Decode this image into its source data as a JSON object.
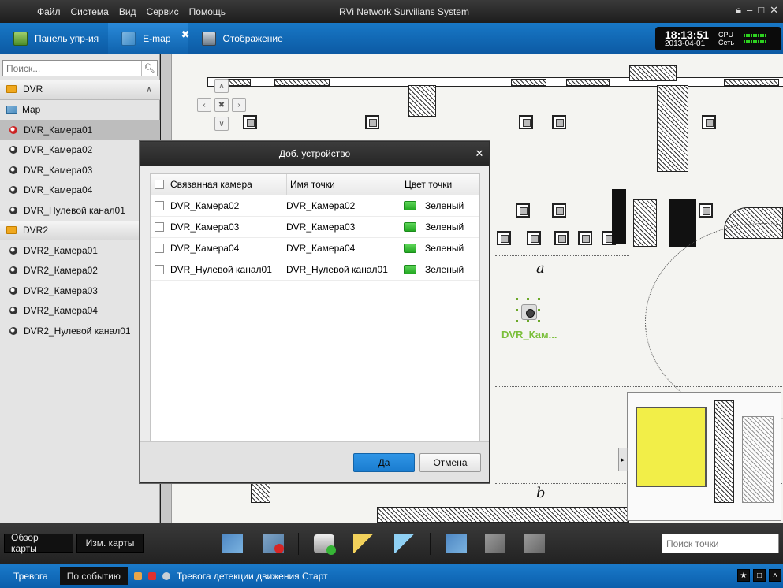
{
  "menubar": {
    "items": [
      "Файл",
      "Система",
      "Вид",
      "Сервис",
      "Помощь"
    ],
    "title": "RVi Network Survilians System",
    "controls": [
      "lock-icon",
      "minimize-icon",
      "maximize-icon",
      "close-icon"
    ]
  },
  "tabs": [
    {
      "label": "Панель упр-ия",
      "icon": "control-panel-icon"
    },
    {
      "label": "E-map",
      "icon": "emap-icon",
      "active": true
    },
    {
      "label": "Отображение",
      "icon": "monitor-icon"
    }
  ],
  "clock": {
    "time": "18:13:51",
    "date": "2013-04-01",
    "cpu_label": "CPU",
    "net_label": "Сеть"
  },
  "sidebar": {
    "search_placeholder": "Поиск...",
    "tree": [
      {
        "label": "DVR",
        "type": "group"
      },
      {
        "label": "Map",
        "type": "map"
      },
      {
        "label": "DVR_Камера01",
        "type": "camera-red",
        "selected": true
      },
      {
        "label": "DVR_Камера02",
        "type": "camera"
      },
      {
        "label": "DVR_Камера03",
        "type": "camera"
      },
      {
        "label": "DVR_Камера04",
        "type": "camera"
      },
      {
        "label": "DVR_Нулевой канал01",
        "type": "camera"
      },
      {
        "label": "DVR2",
        "type": "group"
      },
      {
        "label": "DVR2_Камера01",
        "type": "camera"
      },
      {
        "label": "DVR2_Камера02",
        "type": "camera"
      },
      {
        "label": "DVR2_Камера03",
        "type": "camera"
      },
      {
        "label": "DVR2_Камера04",
        "type": "camera"
      },
      {
        "label": "DVR2_Нулевой канал01",
        "type": "camera"
      }
    ]
  },
  "map": {
    "label_a": "a",
    "label_b": "b",
    "camera_label": "DVR_Кам..."
  },
  "dialog": {
    "title": "Доб. устройство",
    "columns": [
      "Связанная камера",
      "Имя точки",
      "Цвет точки"
    ],
    "rows": [
      {
        "camera": "DVR_Камера02",
        "point": "DVR_Камера02",
        "color": "Зеленый"
      },
      {
        "camera": "DVR_Камера03",
        "point": "DVR_Камера03",
        "color": "Зеленый"
      },
      {
        "camera": "DVR_Камера04",
        "point": "DVR_Камера04",
        "color": "Зеленый"
      },
      {
        "camera": "DVR_Нулевой канал01",
        "point": "DVR_Нулевой канал01",
        "color": "Зеленый"
      }
    ],
    "ok_label": "Да",
    "cancel_label": "Отмена"
  },
  "toolbar": {
    "map_overview": "Обзор карты",
    "edit_map": "Изм. карты",
    "search_placeholder": "Поиск точки",
    "tools": [
      "edit-map-icon",
      "delete-map-icon",
      "add-camera-icon",
      "pencil-icon",
      "eraser-icon",
      "add-hotspot-icon",
      "map-link-icon",
      "delete-hotspot-icon"
    ]
  },
  "statusbar": {
    "tab_alarm": "Тревога",
    "tab_event": "По событию",
    "message": "Тревога детекции движения Старт"
  },
  "colors": {
    "accent_blue": "#0c5aa4",
    "point_green": "#3ac23a",
    "minimap_highlight": "#f0eb28"
  }
}
